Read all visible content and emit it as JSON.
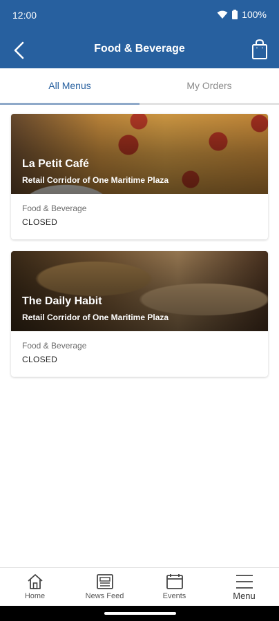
{
  "status_bar": {
    "time": "12:00",
    "battery": "100%"
  },
  "header": {
    "title": "Food & Beverage"
  },
  "tabs": [
    {
      "label": "All Menus",
      "active": true
    },
    {
      "label": "My Orders",
      "active": false
    }
  ],
  "venues": [
    {
      "name": "La Petit Café",
      "location": "Retail Corridor of One Maritime Plaza",
      "category": "Food & Beverage",
      "status": "CLOSED"
    },
    {
      "name": "The Daily Habit",
      "location": "Retail Corridor of One Maritime Plaza",
      "category": "Food & Beverage",
      "status": "CLOSED"
    }
  ],
  "bottom_nav": [
    {
      "label": "Home",
      "icon": "home-icon"
    },
    {
      "label": "News Feed",
      "icon": "news-icon"
    },
    {
      "label": "Events",
      "icon": "calendar-icon"
    },
    {
      "label": "Menu",
      "icon": "hamburger-icon"
    }
  ],
  "colors": {
    "primary": "#27609f",
    "tab_indicator": "#8fa9c9"
  }
}
